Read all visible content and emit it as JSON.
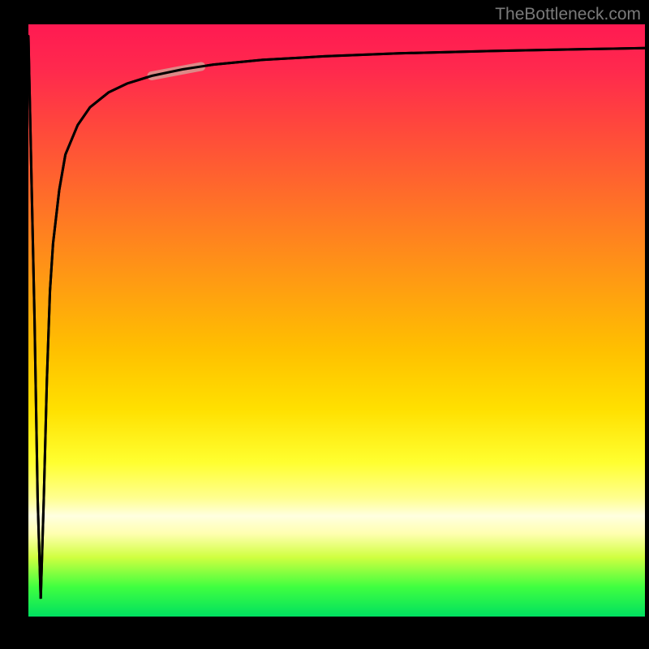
{
  "watermark": "TheBottleneck.com",
  "chart_data": {
    "type": "line",
    "title": "",
    "xlabel": "",
    "ylabel": "",
    "xlim": [
      0,
      100
    ],
    "ylim": [
      0,
      100
    ],
    "x": [
      0,
      1,
      1.5,
      2,
      2.5,
      3,
      3.5,
      4,
      5,
      6,
      8,
      10,
      13,
      16,
      20,
      25,
      30,
      38,
      48,
      60,
      75,
      90,
      100
    ],
    "values": [
      98,
      50,
      20,
      3,
      20,
      40,
      55,
      63,
      72,
      78,
      83,
      86,
      88.5,
      90,
      91.3,
      92.4,
      93.2,
      94,
      94.6,
      95.1,
      95.5,
      95.8,
      96
    ],
    "highlight_x_range": [
      20,
      28
    ],
    "background_gradient": {
      "top": "#ff1a52",
      "middle": "#ffd000",
      "bottom": "#00e060"
    }
  }
}
